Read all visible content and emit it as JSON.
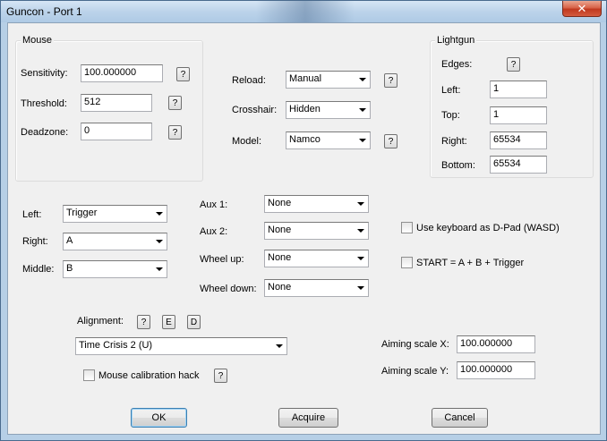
{
  "window": {
    "title": "Guncon - Port 1",
    "close_label": "✕"
  },
  "help_label": "?",
  "mouse": {
    "group_label": "Mouse",
    "sensitivity_label": "Sensitivity:",
    "sensitivity_value": "100.000000",
    "threshold_label": "Threshold:",
    "threshold_value": "512",
    "deadzone_label": "Deadzone:",
    "deadzone_value": "0"
  },
  "center": {
    "reload_label": "Reload:",
    "reload_value": "Manual",
    "crosshair_label": "Crosshair:",
    "crosshair_value": "Hidden",
    "model_label": "Model:",
    "model_value": "Namco"
  },
  "lightgun": {
    "group_label": "Lightgun",
    "edges_label": "Edges:",
    "left_label": "Left:",
    "left_value": "1",
    "top_label": "Top:",
    "top_value": "1",
    "right_label": "Right:",
    "right_value": "65534",
    "bottom_label": "Bottom:",
    "bottom_value": "65534"
  },
  "buttons_map": {
    "left_label": "Left:",
    "left_value": "Trigger",
    "right_label": "Right:",
    "right_value": "A",
    "middle_label": "Middle:",
    "middle_value": "B"
  },
  "aux": {
    "aux1_label": "Aux 1:",
    "aux1_value": "None",
    "aux2_label": "Aux 2:",
    "aux2_value": "None",
    "wheelup_label": "Wheel up:",
    "wheelup_value": "None",
    "wheeldown_label": "Wheel down:",
    "wheeldown_value": "None"
  },
  "options": {
    "keyboard_dpad_label": "Use keyboard as D-Pad (WASD)",
    "start_combo_label": "START = A + B + Trigger"
  },
  "alignment": {
    "label": "Alignment:",
    "e_label": "E",
    "d_label": "D",
    "preset_value": "Time Crisis 2 (U)",
    "calibration_hack_label": "Mouse calibration hack"
  },
  "aiming": {
    "scale_x_label": "Aiming scale X:",
    "scale_x_value": "100.000000",
    "scale_y_label": "Aiming scale Y:",
    "scale_y_value": "100.000000"
  },
  "footer": {
    "ok_label": "OK",
    "acquire_label": "Acquire",
    "cancel_label": "Cancel"
  }
}
